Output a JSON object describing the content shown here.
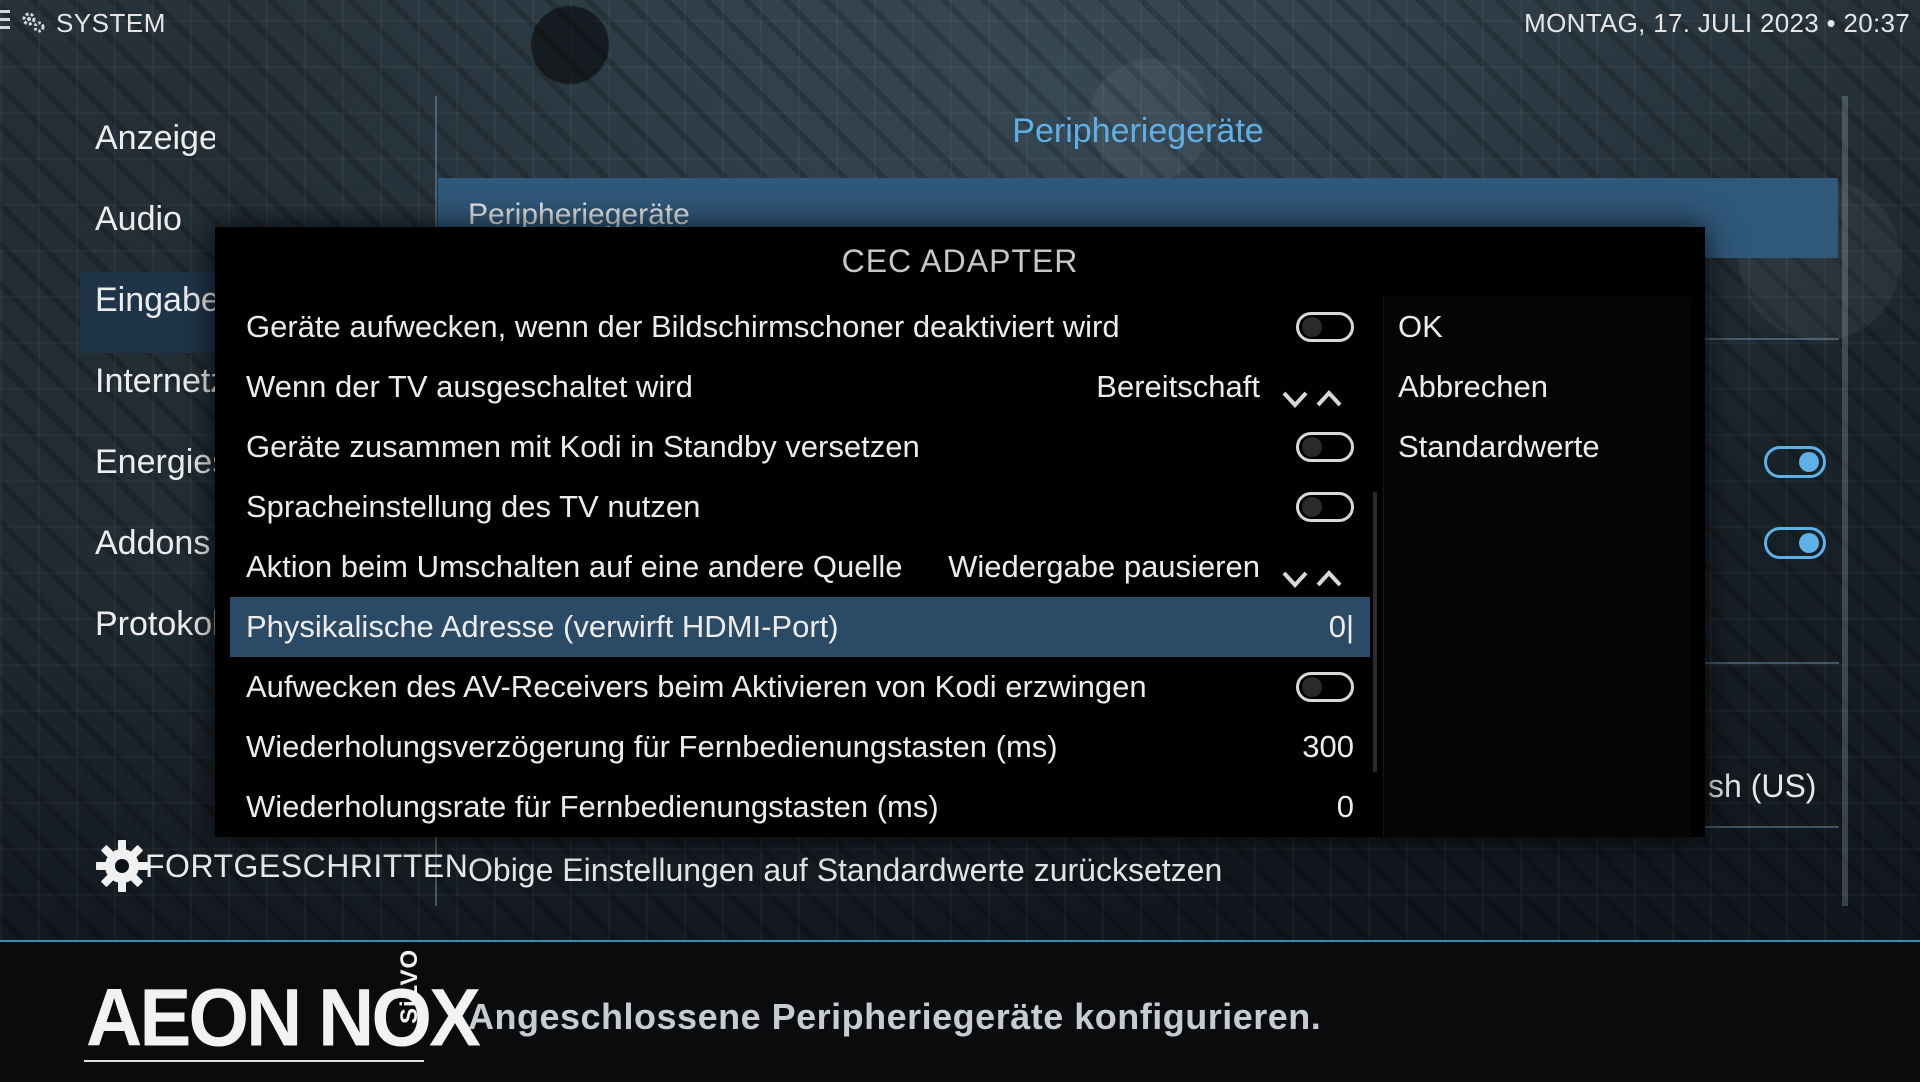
{
  "topbar": {
    "title": "SYSTEM",
    "datetime": "MONTAG, 17. JULI 2023 • 20:37"
  },
  "nav": {
    "items": [
      {
        "label": "Anzeige"
      },
      {
        "label": "Audio"
      },
      {
        "label": "Eingabe",
        "active": true
      },
      {
        "label": "Internetz"
      },
      {
        "label": "Energies"
      },
      {
        "label": "Addons"
      },
      {
        "label": "Protokol"
      }
    ],
    "advanced_label": "FORTGESCHRITTEN"
  },
  "main": {
    "title": "Peripheriegeräte",
    "row_label": "Peripheriegeräte",
    "lang_value": "sh (US)",
    "reset_label": "Obige Einstellungen auf Standardwerte zurücksetzen"
  },
  "dialog": {
    "title": "CEC ADAPTER",
    "settings": [
      {
        "label": "Geräte aufwecken, wenn der Bildschirmschoner deaktiviert wird",
        "type": "toggle",
        "on": false
      },
      {
        "label": "Wenn der TV ausgeschaltet wird",
        "type": "spinner",
        "value": "Bereitschaft"
      },
      {
        "label": "Geräte zusammen mit Kodi in Standby versetzen",
        "type": "toggle",
        "on": false
      },
      {
        "label": "Spracheinstellung des TV nutzen",
        "type": "toggle",
        "on": false
      },
      {
        "label": "Aktion beim Umschalten auf eine andere Quelle",
        "type": "spinner",
        "value": "Wiedergabe pausieren"
      },
      {
        "label": "Physikalische Adresse (verwirft HDMI-Port)",
        "type": "edit",
        "value": "0|",
        "focused": true
      },
      {
        "label": "Aufwecken des AV-Receivers beim Aktivieren von Kodi erzwingen",
        "type": "toggle",
        "on": false
      },
      {
        "label": "Wiederholungsverzögerung für Fernbedienungstasten (ms)",
        "type": "value",
        "value": "300"
      },
      {
        "label": "Wiederholungsrate für Fernbedienungstasten (ms)",
        "type": "value",
        "value": "0"
      }
    ],
    "buttons": {
      "ok": "OK",
      "cancel": "Abbrechen",
      "defaults": "Standardwerte"
    }
  },
  "footer": {
    "logo_main": "AEON NOX",
    "logo_sub": "SiLVO",
    "description": "Angeschlossene Peripheriegeräte konfigurieren."
  },
  "colors": {
    "accent": "#5fb0e6",
    "focus_row": "#2b4a66",
    "active_nav": "#1f3448"
  }
}
